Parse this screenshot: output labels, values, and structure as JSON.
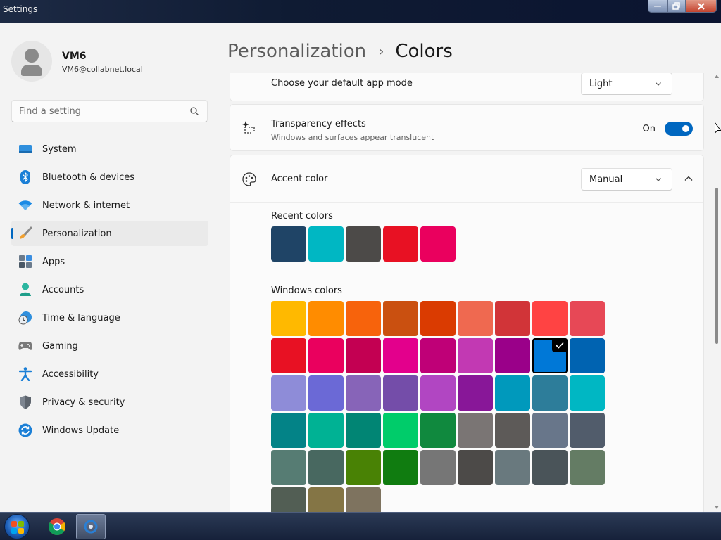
{
  "window": {
    "title": "Settings"
  },
  "user": {
    "name": "VM6",
    "email": "VM6@collabnet.local"
  },
  "search": {
    "placeholder": "Find a setting"
  },
  "nav": [
    {
      "label": "System",
      "icon": "system-icon"
    },
    {
      "label": "Bluetooth & devices",
      "icon": "bluetooth-icon"
    },
    {
      "label": "Network & internet",
      "icon": "wifi-icon"
    },
    {
      "label": "Personalization",
      "icon": "brush-icon",
      "active": true
    },
    {
      "label": "Apps",
      "icon": "apps-icon"
    },
    {
      "label": "Accounts",
      "icon": "accounts-icon"
    },
    {
      "label": "Time & language",
      "icon": "clock-globe-icon"
    },
    {
      "label": "Gaming",
      "icon": "gamepad-icon"
    },
    {
      "label": "Accessibility",
      "icon": "accessibility-icon"
    },
    {
      "label": "Privacy & security",
      "icon": "shield-icon"
    },
    {
      "label": "Windows Update",
      "icon": "update-icon"
    }
  ],
  "breadcrumb": {
    "parent": "Personalization",
    "current": "Colors"
  },
  "app_mode": {
    "label": "Choose your default app mode",
    "value": "Light"
  },
  "transparency": {
    "title": "Transparency effects",
    "subtitle": "Windows and surfaces appear translucent",
    "state_label": "On",
    "enabled": true
  },
  "accent": {
    "title": "Accent color",
    "mode": "Manual",
    "recent_label": "Recent colors",
    "recent_colors": [
      "#1f4466",
      "#00b7c3",
      "#4c4a48",
      "#e81123",
      "#ea005e"
    ],
    "windows_label": "Windows colors",
    "windows_colors": [
      "#ffb900",
      "#ff8c00",
      "#f7630c",
      "#ca5010",
      "#da3b01",
      "#ef6950",
      "#d13438",
      "#ff4343",
      "#e74856",
      "#e81123",
      "#ea005e",
      "#c30052",
      "#e3008c",
      "#bf0077",
      "#c239b3",
      "#9a0089",
      "#0078d7",
      "#0063b1",
      "#8e8cd8",
      "#6b69d6",
      "#8764b8",
      "#744da9",
      "#b146c2",
      "#881798",
      "#0099bc",
      "#2d7d9a",
      "#00b7c3",
      "#038387",
      "#00b294",
      "#018574",
      "#00cc6a",
      "#10893e",
      "#7a7574",
      "#5d5a58",
      "#68768a",
      "#515c6b",
      "#567c73",
      "#486860",
      "#498205",
      "#107c10",
      "#767676",
      "#4c4a48",
      "#69797e",
      "#4a5459",
      "#647c64",
      "#525e54",
      "#847545",
      "#7e735f"
    ],
    "selected_color": "#0078d7"
  },
  "taskbar": {
    "apps": [
      "start-button",
      "chrome-app",
      "settings-app"
    ]
  }
}
